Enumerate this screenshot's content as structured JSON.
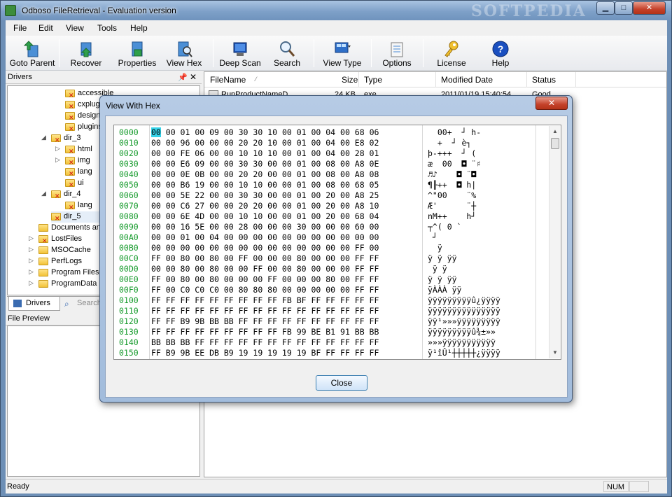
{
  "window": {
    "title": "Odboso FileRetrieval - Evaluation version",
    "watermark": "SOFTPEDIA",
    "minimize_label": "▁",
    "maximize_label": "□",
    "close_label": "✕"
  },
  "menu": [
    "File",
    "Edit",
    "View",
    "Tools",
    "Help"
  ],
  "toolbar": {
    "goto_parent": "Goto Parent",
    "recover": "Recover",
    "properties": "Properties",
    "view_hex": "View Hex",
    "deep_scan": "Deep Scan",
    "search": "Search",
    "view_type": "View Type",
    "options": "Options",
    "license": "License",
    "help": "Help"
  },
  "drivers_panel": {
    "title": "Drivers",
    "pin": "📌",
    "close": "✕",
    "tree": [
      {
        "label": "accessible",
        "indent": 3,
        "deleted": true,
        "arrow": ""
      },
      {
        "label": "cxplug",
        "indent": 3,
        "deleted": true,
        "arrow": ""
      },
      {
        "label": "design",
        "indent": 3,
        "deleted": true,
        "arrow": ""
      },
      {
        "label": "plugins",
        "indent": 3,
        "deleted": true,
        "arrow": ""
      },
      {
        "label": "dir_3",
        "indent": 2,
        "deleted": true,
        "arrow": "◢"
      },
      {
        "label": "html",
        "indent": 3,
        "deleted": true,
        "arrow": "▷"
      },
      {
        "label": "img",
        "indent": 3,
        "deleted": true,
        "arrow": "▷"
      },
      {
        "label": "lang",
        "indent": 3,
        "deleted": true,
        "arrow": ""
      },
      {
        "label": "ui",
        "indent": 3,
        "deleted": true,
        "arrow": ""
      },
      {
        "label": "dir_4",
        "indent": 2,
        "deleted": true,
        "arrow": "◢"
      },
      {
        "label": "lang",
        "indent": 3,
        "deleted": true,
        "arrow": ""
      },
      {
        "label": "dir_5",
        "indent": 2,
        "deleted": true,
        "arrow": "",
        "selected": true
      },
      {
        "label": "Documents and",
        "indent": 1,
        "deleted": false,
        "arrow": ""
      },
      {
        "label": "LostFiles",
        "indent": 1,
        "deleted": true,
        "arrow": "▷"
      },
      {
        "label": "MSOCache",
        "indent": 1,
        "deleted": false,
        "arrow": "▷"
      },
      {
        "label": "PerfLogs",
        "indent": 1,
        "deleted": false,
        "arrow": "▷"
      },
      {
        "label": "Program Files",
        "indent": 1,
        "deleted": false,
        "arrow": "▷"
      },
      {
        "label": "ProgramData",
        "indent": 1,
        "deleted": false,
        "arrow": "▷"
      }
    ],
    "tab_drivers": "Drivers",
    "tab_search": "Search"
  },
  "file_preview": {
    "title": "File Preview"
  },
  "file_list": {
    "columns": [
      "FileName",
      "Size",
      "Type",
      "Modified Date",
      "Status"
    ],
    "rows": [
      {
        "name": "RunProductNameD",
        "size": "24 KB",
        "type": "exe",
        "modified": "2011/01/19 15:40:54",
        "status": "Good"
      }
    ]
  },
  "status_bar": {
    "ready": "Ready",
    "num": "NUM"
  },
  "hex_dialog": {
    "title": "View With Hex",
    "close_x": "✕",
    "close_button": "Close",
    "addresses": [
      "0000",
      "0010",
      "0020",
      "0030",
      "0040",
      "0050",
      "0060",
      "0070",
      "0080",
      "0090",
      "00A0",
      "00B0",
      "00C0",
      "00D0",
      "00E0",
      "00F0",
      "0100",
      "0110",
      "0120",
      "0130",
      "0140",
      "0150"
    ],
    "bytes": [
      "00 00 01 00 09 00 30 30 10 00 01 00 04 00 68 06",
      "00 00 96 00 00 00 20 20 10 00 01 00 04 00 E8 02",
      "00 00 FE 06 00 00 10 10 10 00 01 00 04 00 28 01",
      "00 00 E6 09 00 00 30 30 00 00 01 00 08 00 A8 0E",
      "00 00 0E 0B 00 00 20 20 00 00 01 00 08 00 A8 08",
      "00 00 B6 19 00 00 10 10 00 00 01 00 08 00 68 05",
      "00 00 5E 22 00 00 30 30 00 00 01 00 20 00 A8 25",
      "00 00 C6 27 00 00 20 20 00 00 01 00 20 00 A8 10",
      "00 00 6E 4D 00 00 10 10 00 00 01 00 20 00 68 04",
      "00 00 16 5E 00 00 28 00 00 00 30 00 00 00 60 00",
      "00 00 01 00 04 00 00 00 00 00 00 00 00 00 00 00",
      "00 00 00 00 00 00 00 00 00 00 00 00 00 00 FF 00",
      "FF 00 80 00 80 00 FF 00 00 00 80 00 00 00 FF FF",
      "00 00 80 00 80 00 00 FF 00 00 80 00 00 00 FF FF",
      "FF 00 80 00 80 00 00 00 FF 00 00 00 80 00 FF FF",
      "FF 00 C0 C0 C0 00 80 80 80 00 00 00 00 00 FF FF",
      "FF FF FF FF FF FF FF FF FF FB BF FF FF FF FF FF",
      "FF FF FF FF FF FF FF FF FF FF FF FF FF FF FF FF",
      "FF FF B9 9B BB BB FF FF FF FF FF FF FF FF FF FF",
      "FF FF FF FF FF FF FF FF FF FB 99 BE B1 91 BB BB",
      "BB BB BB FF FF FF FF FF FF FF FF FF FF FF FF FF",
      "FF B9 9B EE DB B9 19 19 19 19 19 BF FF FF FF FF"
    ],
    "ascii": [
      "  00+  ┘ h-",
      "  +  ┘ è┐",
      "þ-+++  ┘ (",
      "æ  00  ◘ ¨♯",
      "♬♪    ◘ ¨◘",
      "¶╟++  ◘ h|",
      "^\"00    ¨%",
      "Æ'      ¨┼",
      "nM++    h┘",
      "┬^( 0 `",
      " ┘",
      "  ÿ",
      "ÿ ÿ ÿÿ",
      " ÿ ÿ",
      "ÿ ÿ ÿÿ",
      "ÿÀÀÀ ÿÿ",
      "ÿÿÿÿÿÿÿÿÿû¿ÿÿÿÿ",
      "ÿÿÿÿÿÿÿÿÿÿÿÿÿÿÿ",
      "ÿÿ¹»»»ÿÿÿÿÿÿÿÿÿ",
      "ÿÿÿÿÿÿÿÿÿû¾±»»",
      "»»»ÿÿÿÿÿÿÿÿÿÿÿ",
      "ÿ¹îÛ¹┼┼┼┼┼¿ÿÿÿÿ"
    ]
  }
}
